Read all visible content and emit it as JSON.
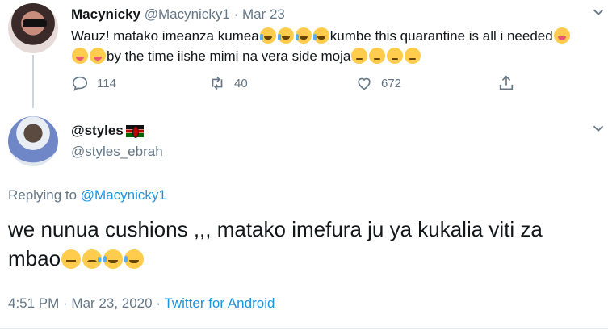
{
  "parent_tweet": {
    "display_name": "Macynicky",
    "handle": "@Macynicky1",
    "separator": "·",
    "date": "Mar 23",
    "text_1": "Wauz! matako imeanza kumea",
    "text_2": "kumbe this quarantine is all i needed",
    "text_3": "by the time iishe mimi na vera  side moja",
    "reply_count": "114",
    "retweet_count": "40",
    "like_count": "672"
  },
  "main_tweet": {
    "display_name": "@styles",
    "handle": "@styles_ebrah",
    "replying_prefix": "Replying to ",
    "replying_to": "@Macynicky1",
    "text": "we nunua cushions ,,, matako imefura ju ya kukalia viti za mbao",
    "time": "4:51 PM",
    "separator": " · ",
    "date": "Mar 23, 2020",
    "separator_2": " · ",
    "source": "Twitter for Android"
  },
  "icons": [
    "reply-icon",
    "retweet-icon",
    "like-icon",
    "share-icon",
    "chevron-down-icon",
    "kenya-flag-icon"
  ],
  "colors": {
    "link": "#1b95e0",
    "secondary_text": "#657786",
    "primary_text": "#14171a"
  }
}
